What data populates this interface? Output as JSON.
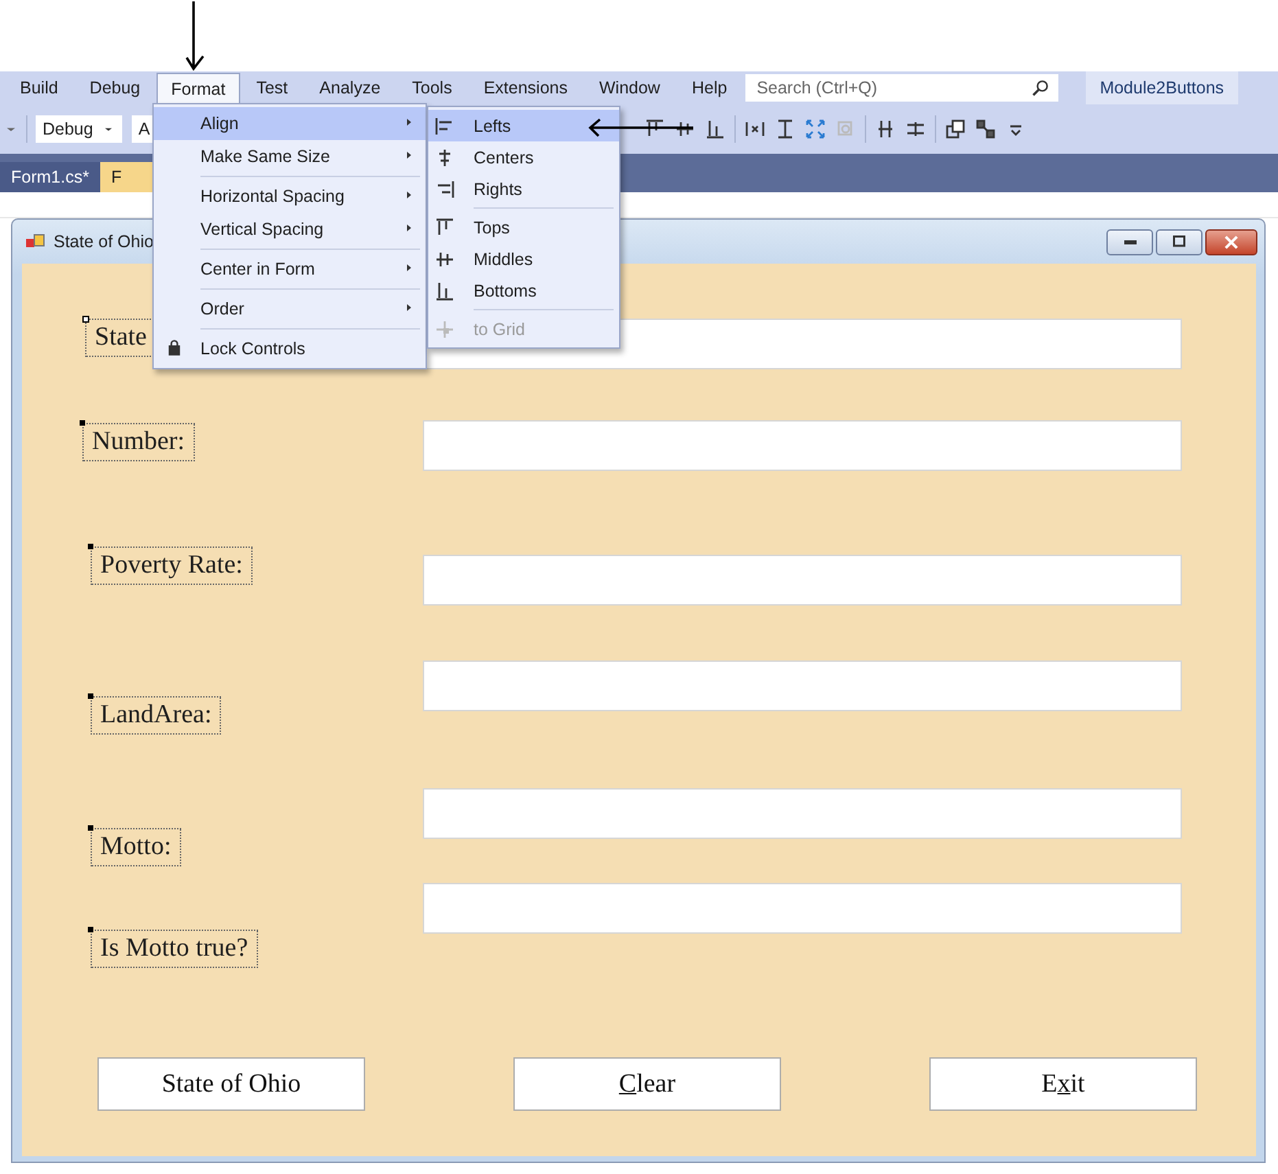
{
  "menubar": {
    "items": [
      {
        "label": "Build",
        "selected": false
      },
      {
        "label": "Debug",
        "selected": false
      },
      {
        "label": "Format",
        "selected": true
      },
      {
        "label": "Test",
        "selected": false
      },
      {
        "label": "Analyze",
        "selected": false
      },
      {
        "label": "Tools",
        "selected": false
      },
      {
        "label": "Extensions",
        "selected": false
      },
      {
        "label": "Window",
        "selected": false
      },
      {
        "label": "Help",
        "selected": false
      }
    ],
    "search": {
      "placeholder": "Search (Ctrl+Q)"
    },
    "solution_name": "Module2Buttons"
  },
  "toolbar": {
    "dropdowns": [
      "Debug",
      "A"
    ]
  },
  "tabs": [
    {
      "label": "Form1.cs*",
      "selected": false
    },
    {
      "label": "F",
      "selected": true
    }
  ],
  "format_menu": {
    "items": [
      {
        "kind": "submenu",
        "label": "Align",
        "selected": true
      },
      {
        "kind": "submenu",
        "label": "Make Same Size",
        "selected": false
      },
      {
        "kind": "separator"
      },
      {
        "kind": "submenu",
        "label": "Horizontal Spacing",
        "selected": false
      },
      {
        "kind": "submenu",
        "label": "Vertical Spacing",
        "selected": false
      },
      {
        "kind": "separator"
      },
      {
        "kind": "submenu",
        "label": "Center in Form",
        "selected": false
      },
      {
        "kind": "separator"
      },
      {
        "kind": "submenu",
        "label": "Order",
        "selected": false
      },
      {
        "kind": "separator"
      },
      {
        "kind": "command",
        "label": "Lock Controls",
        "selected": false
      }
    ]
  },
  "align_submenu": {
    "items": [
      {
        "kind": "command",
        "label": "Lefts",
        "selected": true,
        "disabled": false
      },
      {
        "kind": "command",
        "label": "Centers",
        "selected": false,
        "disabled": false
      },
      {
        "kind": "command",
        "label": "Rights",
        "selected": false,
        "disabled": false
      },
      {
        "kind": "separator"
      },
      {
        "kind": "command",
        "label": "Tops",
        "selected": false,
        "disabled": false
      },
      {
        "kind": "command",
        "label": "Middles",
        "selected": false,
        "disabled": false
      },
      {
        "kind": "command",
        "label": "Bottoms",
        "selected": false,
        "disabled": false
      },
      {
        "kind": "separator"
      },
      {
        "kind": "command",
        "label": "to Grid",
        "selected": false,
        "disabled": true
      }
    ]
  },
  "form_window": {
    "title": "State of Ohio",
    "rows": [
      {
        "label": "State",
        "primary_selection": true
      },
      {
        "label": "Number:",
        "primary_selection": false
      },
      {
        "label": "Poverty Rate:",
        "primary_selection": false
      },
      {
        "label": "LandArea:",
        "primary_selection": false
      },
      {
        "label": "Motto:",
        "primary_selection": false
      },
      {
        "label": "Is Motto true?",
        "primary_selection": false
      }
    ],
    "buttons": [
      {
        "parts": [
          {
            "text": "State of Ohio",
            "underlined": false
          }
        ]
      },
      {
        "parts": [
          {
            "text": "C",
            "underlined": true
          },
          {
            "text": "lear",
            "underlined": false
          }
        ]
      },
      {
        "parts": [
          {
            "text": "E",
            "underlined": false
          },
          {
            "text": "x",
            "underlined": true
          },
          {
            "text": "it",
            "underlined": false
          }
        ]
      }
    ]
  }
}
